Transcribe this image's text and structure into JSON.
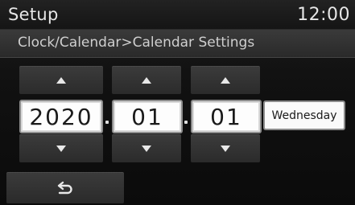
{
  "header": {
    "title": "Setup",
    "clock": "12:00"
  },
  "breadcrumb": "Clock/Calendar>Calendar Settings",
  "date": {
    "year": "2020",
    "month": "01",
    "day": "01",
    "separator": ".",
    "weekday": "Wednesday"
  },
  "icons": {
    "increment": "triangle-up",
    "decrement": "triangle-down",
    "back": "return-arrow"
  },
  "colors": {
    "background": "#111111",
    "bar": "#2e2e2e",
    "text": "#e6e6e6",
    "field_bg": "#fdfdfd"
  }
}
